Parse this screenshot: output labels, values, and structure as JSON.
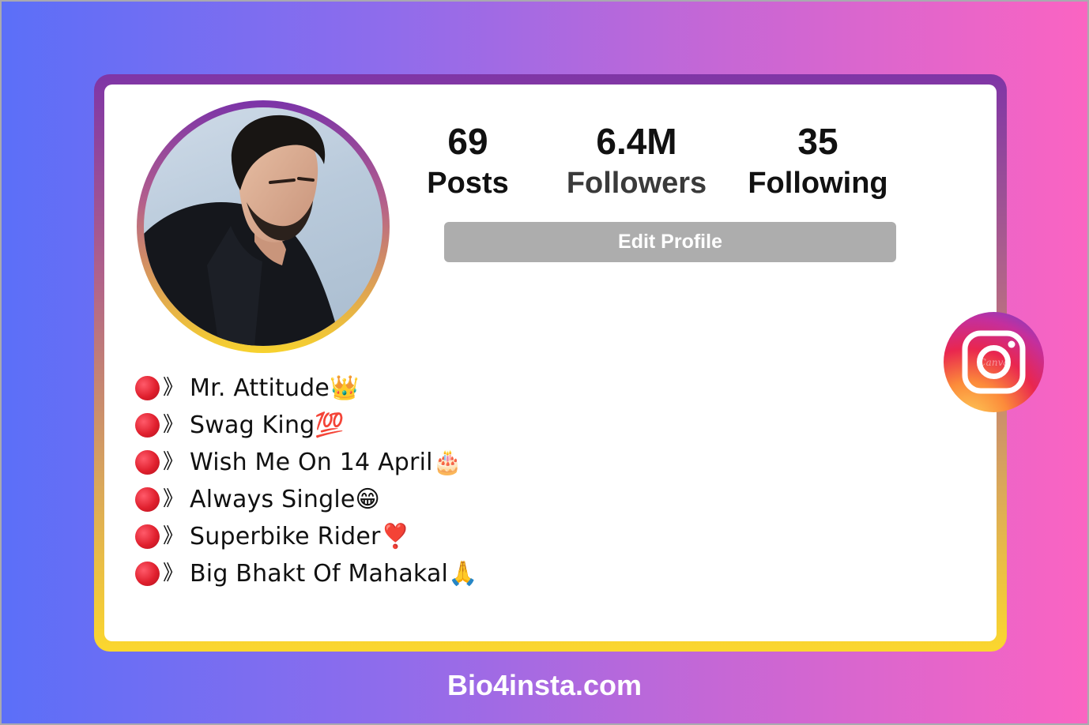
{
  "profile": {
    "stats": {
      "posts_count": "69",
      "posts_label": "Posts",
      "followers_count": "6.4M",
      "followers_label": "Followers",
      "following_count": "35",
      "following_label": "Following"
    },
    "edit_button_label": "Edit Profile",
    "bio_bullet_glyph": "》",
    "bio": [
      "Mr. Attitude👑",
      "Swag King💯",
      "Wish Me On 14 April🎂",
      "Always Single😁",
      "Superbike Rider❣️",
      "Big Bhakt Of Mahakal🙏"
    ],
    "badge_watermark": "Canva"
  },
  "footer": {
    "site_text": "Bio4insta.com"
  },
  "colors": {
    "background_left": "#5b6ff8",
    "background_right": "#fb64c2",
    "card_border_top": "#7f35a6",
    "card_border_bottom": "#fbd72e",
    "edit_button": "#adadad",
    "bio_dot": "#e0202e"
  },
  "icons": {
    "bio_bullet": "red-circle-icon",
    "badge": "instagram-icon"
  }
}
